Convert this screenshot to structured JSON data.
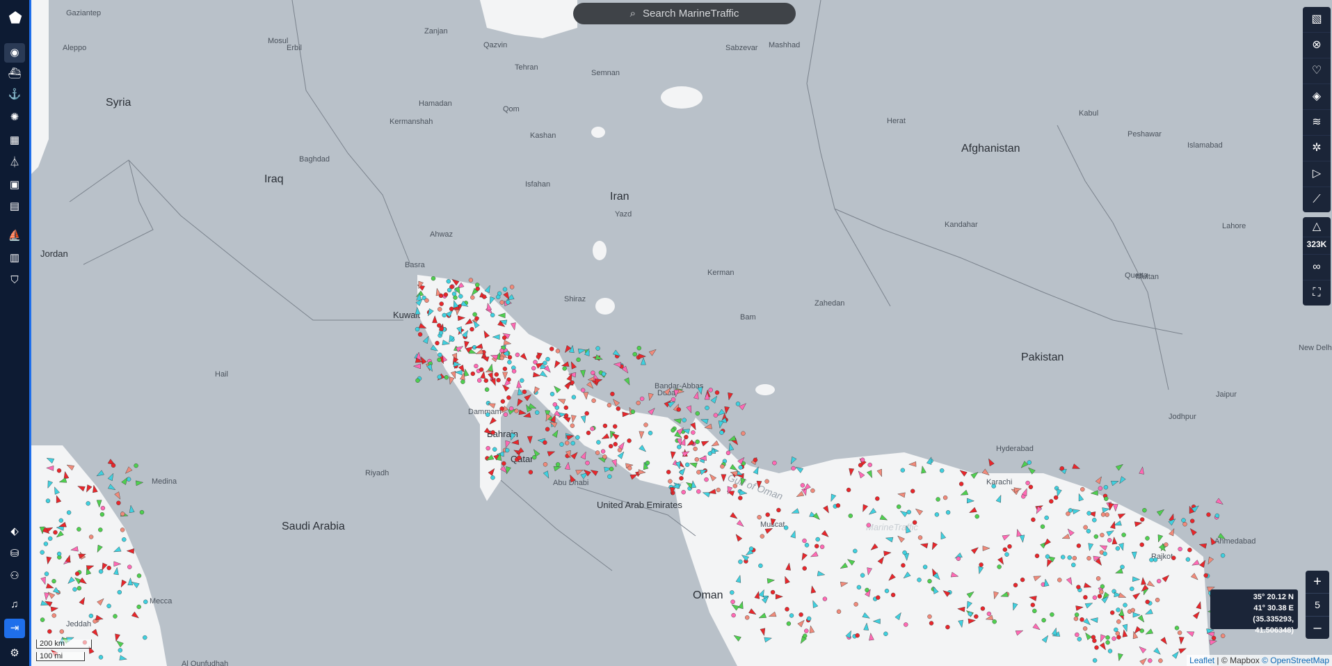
{
  "search": {
    "placeholder": "Search MarineTraffic",
    "icon": "search-icon"
  },
  "sidebar": {
    "logo": "marinetraffic-logo",
    "items": [
      "globe-icon",
      "ship-icon",
      "anchor-icon",
      "storm-icon",
      "building-icon",
      "antenna-icon",
      "photo-icon",
      "news-icon",
      "vessel-icon",
      "container-icon",
      "shield-icon"
    ],
    "bottom": [
      "tag-icon",
      "database-icon",
      "fleet-icon",
      "bell-icon",
      "login-icon",
      "settings-icon"
    ]
  },
  "right_toolbar": {
    "tools": [
      "map-icon",
      "filter-icon",
      "heart-icon",
      "layers-icon",
      "weather-icon",
      "density-icon",
      "play-icon",
      "measure-icon"
    ],
    "vessel_count": "323K",
    "extra": [
      "infinity-icon",
      "fullscreen-icon"
    ]
  },
  "zoom": {
    "in": "+",
    "level": "5",
    "out": "–"
  },
  "coordinates": {
    "lat": "35° 20.12 N",
    "lon": "41° 30.38 E",
    "decimal": "(35.335293, 41.506348)"
  },
  "scale": {
    "km": "200 km",
    "mi": "100 mi"
  },
  "attribution": {
    "leaflet": "Leaflet",
    "mapbox": "© Mapbox",
    "osm": "© OpenStreetMap"
  },
  "labels": {
    "countries": [
      "Syria",
      "Iraq",
      "Iran",
      "Afghanistan",
      "Pakistan",
      "Saudi Arabia",
      "Oman",
      "Jordan",
      "Kuwait",
      "Qatar",
      "Bahrain",
      "United Arab Emirates"
    ],
    "cities": [
      "Gaziantep",
      "Aleppo",
      "Mosul",
      "Erbil",
      "Tehran",
      "Qazvin",
      "Zanjan",
      "Semnan",
      "Mashhad",
      "Sabzevar",
      "Baghdad",
      "Kermanshah",
      "Hamadan",
      "Qom",
      "Kashan",
      "Isfahan",
      "Yazd",
      "Shiraz",
      "Kerman",
      "Bam",
      "Zahedan",
      "Basra",
      "Ahwaz",
      "Riyadh",
      "Medina",
      "Mecca",
      "Jeddah",
      "Muscat",
      "Karachi",
      "Hyderabad",
      "Lahore",
      "Multan",
      "Quetta",
      "Kandahar",
      "Herat",
      "Kabul",
      "Peshawar",
      "Islamabad",
      "Dammam",
      "Abu Dhabi",
      "Dubai",
      "Bandar-Abbas",
      "Jodhpur",
      "Jaipur",
      "Ahmedabad",
      "Rajkot",
      "New Delhi",
      "Hail",
      "Al Qunfudhah"
    ],
    "seas": [
      "Gulf of Oman",
      "MarineTraffic"
    ]
  }
}
